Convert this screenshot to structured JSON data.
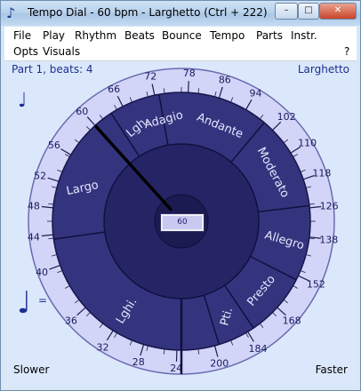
{
  "window": {
    "title": "Tempo Dial - 60 bpm - Larghetto (Ctrl + 222)",
    "app_icon_glyph": "♪",
    "buttons": {
      "minimize": "–",
      "maximize": "□",
      "close": "✕"
    }
  },
  "menu": {
    "row1": [
      "File",
      "Play",
      "Rhythm",
      "Beats",
      "Bounce",
      "Tempo",
      "Parts",
      "Instr."
    ],
    "row2": [
      "Opts",
      "Visuals"
    ],
    "help": "?"
  },
  "dial": {
    "part_info": "Part 1, beats: 4",
    "tempo_name": "Larghetto",
    "bpm_value": "60",
    "slower_label": "Slower",
    "faster_label": "Faster",
    "small_note_glyph": "♩",
    "big_note_glyph": "♩",
    "big_note_eq": "=",
    "ticks": [
      {
        "bpm": 40,
        "label": "40"
      },
      {
        "bpm": 44,
        "label": "44"
      },
      {
        "bpm": 48,
        "label": "48"
      },
      {
        "bpm": 52,
        "label": "52"
      },
      {
        "bpm": 56,
        "label": "56"
      },
      {
        "bpm": 60,
        "label": "60"
      },
      {
        "bpm": 66,
        "label": "66"
      },
      {
        "bpm": 72,
        "label": "72"
      },
      {
        "bpm": 78,
        "label": "78"
      },
      {
        "bpm": 86,
        "label": "86"
      },
      {
        "bpm": 94,
        "label": "94"
      },
      {
        "bpm": 102,
        "label": "102"
      },
      {
        "bpm": 110,
        "label": "110"
      },
      {
        "bpm": 118,
        "label": "118"
      },
      {
        "bpm": 126,
        "label": "126"
      },
      {
        "bpm": 138,
        "label": "138"
      },
      {
        "bpm": 152,
        "label": "152"
      },
      {
        "bpm": 168,
        "label": "168"
      },
      {
        "bpm": 184,
        "label": "184"
      },
      {
        "bpm": 200,
        "label": "200"
      },
      {
        "bpm": 24,
        "label": "24"
      },
      {
        "bpm": 28,
        "label": "28"
      },
      {
        "bpm": 32,
        "label": "32"
      },
      {
        "bpm": 36,
        "label": "36"
      }
    ],
    "sectors": [
      {
        "name": "Largo",
        "label": "Largo"
      },
      {
        "name": "Lgh.",
        "label": "Lgh."
      },
      {
        "name": "Adagio",
        "label": "Adagio"
      },
      {
        "name": "Andante",
        "label": "Andante"
      },
      {
        "name": "Moderato",
        "label": "Moderato"
      },
      {
        "name": "Allegro",
        "label": "Allegro"
      },
      {
        "name": "Presto",
        "label": "Presto"
      },
      {
        "name": "Pti.",
        "label": "Pti."
      },
      {
        "name": "Lghi.",
        "label": "Lghi."
      }
    ],
    "colors": {
      "outer_ring": "#d2d5f7",
      "mid_ring": "#34347e",
      "inner_disc": "#252566",
      "hub": "#1b1b52",
      "tick": "#1c1c50",
      "label_text": "#1a1a5c",
      "sector_text": "#e4e6ff"
    }
  }
}
